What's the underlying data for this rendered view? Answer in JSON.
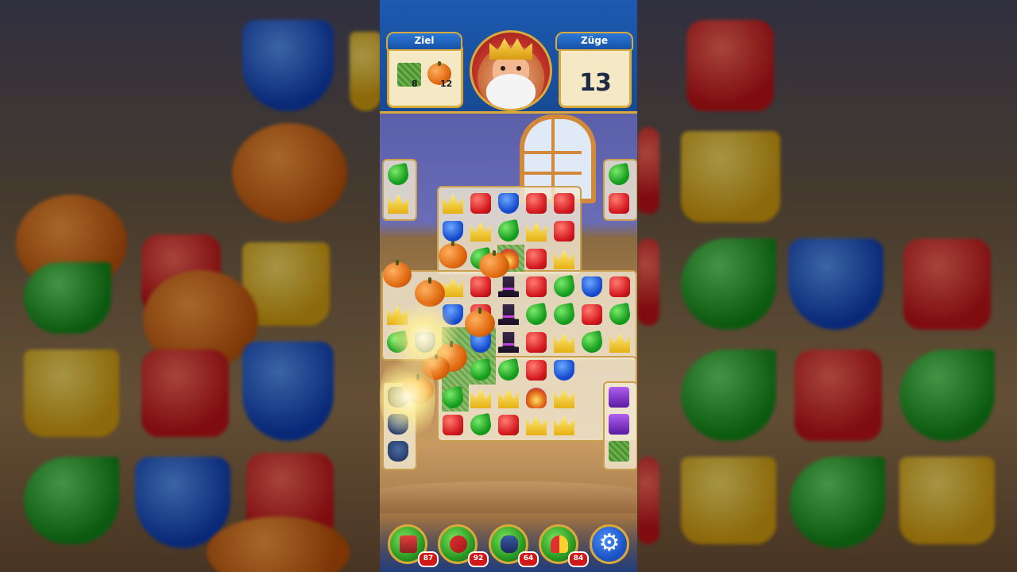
{
  "header": {
    "goal_label": "Ziel",
    "moves_label": "Züge",
    "moves_value": "13",
    "goals": [
      {
        "icon": "grass-tile-icon",
        "count": "8"
      },
      {
        "icon": "pumpkin-icon",
        "count": "12"
      }
    ]
  },
  "boosters": [
    {
      "icon": "hammer-booster-icon",
      "count": "87"
    },
    {
      "icon": "arrow-booster-icon",
      "count": "92"
    },
    {
      "icon": "cannon-booster-icon",
      "count": "64"
    },
    {
      "icon": "jester-hat-booster-icon",
      "count": "84"
    }
  ],
  "settings": {
    "icon": "gear-icon"
  },
  "colors": {
    "topbar": "#1d5ab0",
    "gold_border": "#d9a93a",
    "panel": "#f5e8c4",
    "badge": "#d01818"
  },
  "board": {
    "tile_types": [
      "red-box",
      "blue-shield",
      "green-leaf",
      "yellow-crown",
      "pumpkin",
      "magic-hat",
      "jester",
      "cauldron",
      "purple-box",
      "grass-box"
    ]
  }
}
